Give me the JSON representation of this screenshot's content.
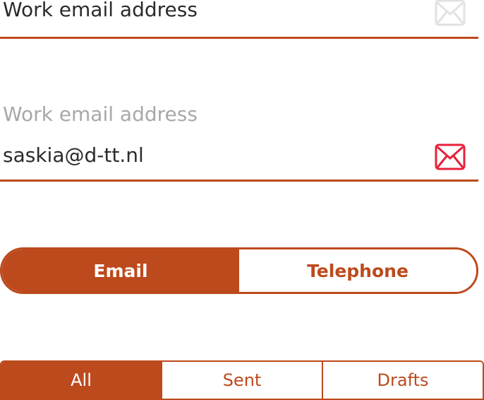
{
  "colors": {
    "accent": "#bc4a1d",
    "error": "#e8203a",
    "placeholder": "#a8a8a8",
    "text": "#2b2b2b",
    "disabled_icon": "#e2e2e2"
  },
  "field_empty": {
    "placeholder": "Work email address",
    "icon": "envelope-icon"
  },
  "field_filled": {
    "label": "Work email address",
    "value": "saskia@d-tt.nl",
    "icon": "envelope-icon"
  },
  "contact_toggle": {
    "selected": "Email",
    "options": [
      "Email",
      "Telephone"
    ]
  },
  "filter_tabs": {
    "selected": "All",
    "options": [
      "All",
      "Sent",
      "Drafts"
    ]
  }
}
